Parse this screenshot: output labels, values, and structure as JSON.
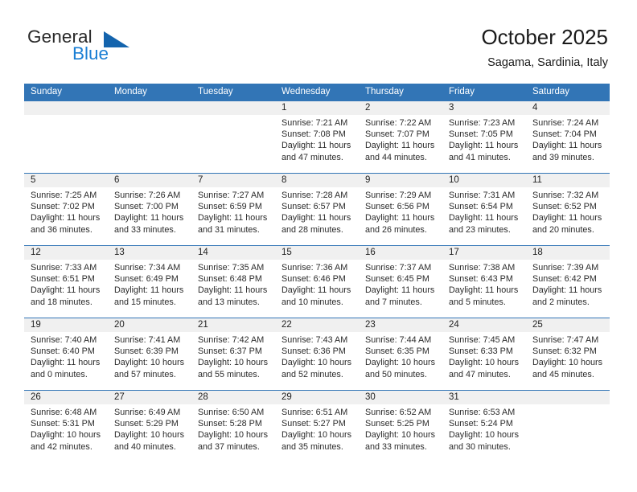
{
  "brand": {
    "name_top": "General",
    "name_bottom": "Blue",
    "triangle_color": "#1464ad",
    "blue_color": "#1b7fd4"
  },
  "header": {
    "title": "October 2025",
    "subtitle": "Sagama, Sardinia, Italy"
  },
  "theme": {
    "header_blue": "#3275b6",
    "daynum_band": "#f0f0f0",
    "text": "#2b2b2b"
  },
  "weekday_headers": [
    "Sunday",
    "Monday",
    "Tuesday",
    "Wednesday",
    "Thursday",
    "Friday",
    "Saturday"
  ],
  "weeks": [
    [
      {
        "day": "",
        "sunrise": "",
        "sunset": "",
        "daylight_1": "",
        "daylight_2": ""
      },
      {
        "day": "",
        "sunrise": "",
        "sunset": "",
        "daylight_1": "",
        "daylight_2": ""
      },
      {
        "day": "",
        "sunrise": "",
        "sunset": "",
        "daylight_1": "",
        "daylight_2": ""
      },
      {
        "day": "1",
        "sunrise": "Sunrise: 7:21 AM",
        "sunset": "Sunset: 7:08 PM",
        "daylight_1": "Daylight: 11 hours",
        "daylight_2": "and 47 minutes."
      },
      {
        "day": "2",
        "sunrise": "Sunrise: 7:22 AM",
        "sunset": "Sunset: 7:07 PM",
        "daylight_1": "Daylight: 11 hours",
        "daylight_2": "and 44 minutes."
      },
      {
        "day": "3",
        "sunrise": "Sunrise: 7:23 AM",
        "sunset": "Sunset: 7:05 PM",
        "daylight_1": "Daylight: 11 hours",
        "daylight_2": "and 41 minutes."
      },
      {
        "day": "4",
        "sunrise": "Sunrise: 7:24 AM",
        "sunset": "Sunset: 7:04 PM",
        "daylight_1": "Daylight: 11 hours",
        "daylight_2": "and 39 minutes."
      }
    ],
    [
      {
        "day": "5",
        "sunrise": "Sunrise: 7:25 AM",
        "sunset": "Sunset: 7:02 PM",
        "daylight_1": "Daylight: 11 hours",
        "daylight_2": "and 36 minutes."
      },
      {
        "day": "6",
        "sunrise": "Sunrise: 7:26 AM",
        "sunset": "Sunset: 7:00 PM",
        "daylight_1": "Daylight: 11 hours",
        "daylight_2": "and 33 minutes."
      },
      {
        "day": "7",
        "sunrise": "Sunrise: 7:27 AM",
        "sunset": "Sunset: 6:59 PM",
        "daylight_1": "Daylight: 11 hours",
        "daylight_2": "and 31 minutes."
      },
      {
        "day": "8",
        "sunrise": "Sunrise: 7:28 AM",
        "sunset": "Sunset: 6:57 PM",
        "daylight_1": "Daylight: 11 hours",
        "daylight_2": "and 28 minutes."
      },
      {
        "day": "9",
        "sunrise": "Sunrise: 7:29 AM",
        "sunset": "Sunset: 6:56 PM",
        "daylight_1": "Daylight: 11 hours",
        "daylight_2": "and 26 minutes."
      },
      {
        "day": "10",
        "sunrise": "Sunrise: 7:31 AM",
        "sunset": "Sunset: 6:54 PM",
        "daylight_1": "Daylight: 11 hours",
        "daylight_2": "and 23 minutes."
      },
      {
        "day": "11",
        "sunrise": "Sunrise: 7:32 AM",
        "sunset": "Sunset: 6:52 PM",
        "daylight_1": "Daylight: 11 hours",
        "daylight_2": "and 20 minutes."
      }
    ],
    [
      {
        "day": "12",
        "sunrise": "Sunrise: 7:33 AM",
        "sunset": "Sunset: 6:51 PM",
        "daylight_1": "Daylight: 11 hours",
        "daylight_2": "and 18 minutes."
      },
      {
        "day": "13",
        "sunrise": "Sunrise: 7:34 AM",
        "sunset": "Sunset: 6:49 PM",
        "daylight_1": "Daylight: 11 hours",
        "daylight_2": "and 15 minutes."
      },
      {
        "day": "14",
        "sunrise": "Sunrise: 7:35 AM",
        "sunset": "Sunset: 6:48 PM",
        "daylight_1": "Daylight: 11 hours",
        "daylight_2": "and 13 minutes."
      },
      {
        "day": "15",
        "sunrise": "Sunrise: 7:36 AM",
        "sunset": "Sunset: 6:46 PM",
        "daylight_1": "Daylight: 11 hours",
        "daylight_2": "and 10 minutes."
      },
      {
        "day": "16",
        "sunrise": "Sunrise: 7:37 AM",
        "sunset": "Sunset: 6:45 PM",
        "daylight_1": "Daylight: 11 hours",
        "daylight_2": "and 7 minutes."
      },
      {
        "day": "17",
        "sunrise": "Sunrise: 7:38 AM",
        "sunset": "Sunset: 6:43 PM",
        "daylight_1": "Daylight: 11 hours",
        "daylight_2": "and 5 minutes."
      },
      {
        "day": "18",
        "sunrise": "Sunrise: 7:39 AM",
        "sunset": "Sunset: 6:42 PM",
        "daylight_1": "Daylight: 11 hours",
        "daylight_2": "and 2 minutes."
      }
    ],
    [
      {
        "day": "19",
        "sunrise": "Sunrise: 7:40 AM",
        "sunset": "Sunset: 6:40 PM",
        "daylight_1": "Daylight: 11 hours",
        "daylight_2": "and 0 minutes."
      },
      {
        "day": "20",
        "sunrise": "Sunrise: 7:41 AM",
        "sunset": "Sunset: 6:39 PM",
        "daylight_1": "Daylight: 10 hours",
        "daylight_2": "and 57 minutes."
      },
      {
        "day": "21",
        "sunrise": "Sunrise: 7:42 AM",
        "sunset": "Sunset: 6:37 PM",
        "daylight_1": "Daylight: 10 hours",
        "daylight_2": "and 55 minutes."
      },
      {
        "day": "22",
        "sunrise": "Sunrise: 7:43 AM",
        "sunset": "Sunset: 6:36 PM",
        "daylight_1": "Daylight: 10 hours",
        "daylight_2": "and 52 minutes."
      },
      {
        "day": "23",
        "sunrise": "Sunrise: 7:44 AM",
        "sunset": "Sunset: 6:35 PM",
        "daylight_1": "Daylight: 10 hours",
        "daylight_2": "and 50 minutes."
      },
      {
        "day": "24",
        "sunrise": "Sunrise: 7:45 AM",
        "sunset": "Sunset: 6:33 PM",
        "daylight_1": "Daylight: 10 hours",
        "daylight_2": "and 47 minutes."
      },
      {
        "day": "25",
        "sunrise": "Sunrise: 7:47 AM",
        "sunset": "Sunset: 6:32 PM",
        "daylight_1": "Daylight: 10 hours",
        "daylight_2": "and 45 minutes."
      }
    ],
    [
      {
        "day": "26",
        "sunrise": "Sunrise: 6:48 AM",
        "sunset": "Sunset: 5:31 PM",
        "daylight_1": "Daylight: 10 hours",
        "daylight_2": "and 42 minutes."
      },
      {
        "day": "27",
        "sunrise": "Sunrise: 6:49 AM",
        "sunset": "Sunset: 5:29 PM",
        "daylight_1": "Daylight: 10 hours",
        "daylight_2": "and 40 minutes."
      },
      {
        "day": "28",
        "sunrise": "Sunrise: 6:50 AM",
        "sunset": "Sunset: 5:28 PM",
        "daylight_1": "Daylight: 10 hours",
        "daylight_2": "and 37 minutes."
      },
      {
        "day": "29",
        "sunrise": "Sunrise: 6:51 AM",
        "sunset": "Sunset: 5:27 PM",
        "daylight_1": "Daylight: 10 hours",
        "daylight_2": "and 35 minutes."
      },
      {
        "day": "30",
        "sunrise": "Sunrise: 6:52 AM",
        "sunset": "Sunset: 5:25 PM",
        "daylight_1": "Daylight: 10 hours",
        "daylight_2": "and 33 minutes."
      },
      {
        "day": "31",
        "sunrise": "Sunrise: 6:53 AM",
        "sunset": "Sunset: 5:24 PM",
        "daylight_1": "Daylight: 10 hours",
        "daylight_2": "and 30 minutes."
      },
      {
        "day": "",
        "sunrise": "",
        "sunset": "",
        "daylight_1": "",
        "daylight_2": ""
      }
    ]
  ]
}
